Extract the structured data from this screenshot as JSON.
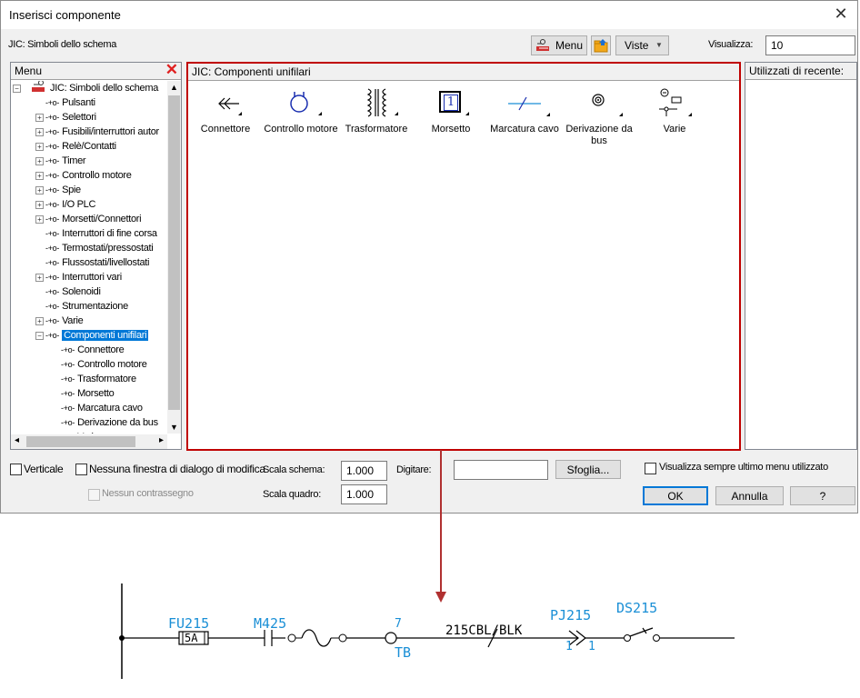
{
  "window": {
    "title": "Inserisci componente"
  },
  "toolbar": {
    "library_label": "JIC: Simboli dello schema",
    "menu_button": "Menu",
    "views_button": "Viste",
    "display_label": "Visualizza:",
    "display_value": "10"
  },
  "menu_panel": {
    "header": "Menu",
    "root": "JIC: Simboli dello schema",
    "items": [
      "Pulsanti",
      "Selettori",
      "Fusibili/interruttori autor",
      "Relè/Contatti",
      "Timer",
      "Controllo motore",
      "Spie",
      "I/O PLC",
      "Morsetti/Connettori",
      "Interruttori di fine corsa",
      "Termostati/pressostati",
      "Flussostati/livellostati",
      "Interruttori vari",
      "Solenoidi",
      "Strumentazione",
      "Varie",
      "Componenti unifilari"
    ],
    "subitems": [
      "Connettore",
      "Controllo motore",
      "Trasformatore",
      "Morsetto",
      "Marcatura cavo",
      "Derivazione da bus",
      "Varie"
    ]
  },
  "main_panel": {
    "header": "JIC: Componenti unifilari",
    "symbols": [
      "Connettore",
      "Controllo motore",
      "Trasformatore",
      "Morsetto",
      "Marcatura cavo",
      "Derivazione da bus",
      "Varie"
    ],
    "morsetto_number": "1"
  },
  "recent_panel": {
    "header": "Utilizzati di recente:"
  },
  "options": {
    "vertical": "Verticale",
    "no_dialog": "Nessuna finestra di dialogo di modifica",
    "no_tag": "Nessun contrassegno",
    "schema_scale_label": "Scala schema:",
    "schema_scale_value": "1.000",
    "frame_scale_label": "Scala quadro:",
    "frame_scale_value": "1.000",
    "type_label": "Digitare:",
    "type_value": "",
    "browse_button": "Sfoglia...",
    "always_show_last": "Visualizza sempre ultimo menu utilizzato"
  },
  "buttons": {
    "ok": "OK",
    "cancel": "Annulla",
    "help": "?"
  },
  "colors": {
    "highlight": "#c00000",
    "selection": "#0078d7",
    "cad_blue": "#1a8fd6"
  },
  "cad": {
    "fuse_tag": "FU215",
    "fuse_rating": "5A",
    "motor_tag": "M425",
    "terminal_num": "7",
    "terminal_tag": "TB",
    "wire_tag": "215CBL/BLK",
    "connector_tag": "PJ215",
    "connector_pin_left": "1",
    "connector_pin_right": "1",
    "switch_tag": "DS215"
  }
}
